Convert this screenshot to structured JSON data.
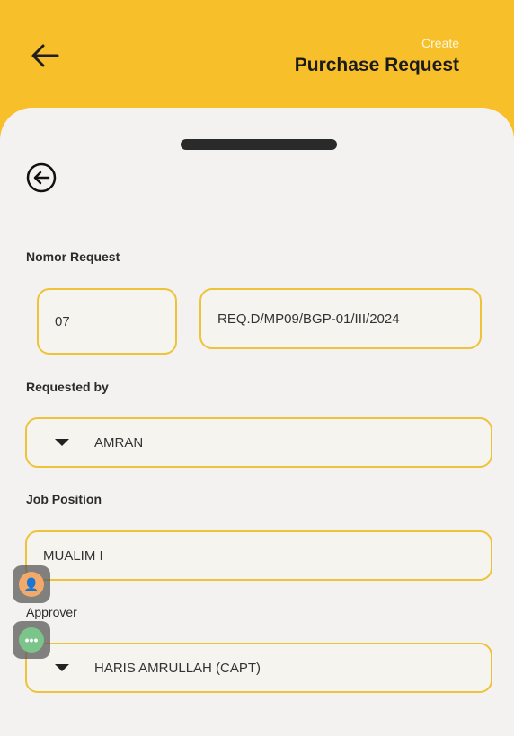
{
  "header": {
    "subtitle": "Create",
    "title": "Purchase Request"
  },
  "form": {
    "nomor_request_label": "Nomor Request",
    "nomor_number": "07",
    "nomor_code": "REQ.D/MP09/BGP-01/III/2024",
    "requested_by_label": "Requested by",
    "requested_by_value": "AMRAN",
    "job_position_label": "Job Position",
    "job_position_value": "MUALIM I",
    "approver_label": "Approver",
    "approver_value": "HARIS AMRULLAH (CAPT)"
  },
  "colors": {
    "accent": "#f7bf2a",
    "field_border": "#eec33a",
    "sheet": "#f3f2f0"
  },
  "icons": [
    "back-arrow-icon",
    "circle-back-icon",
    "caret-down-icon",
    "accessibility-icon",
    "more-dots-icon"
  ]
}
